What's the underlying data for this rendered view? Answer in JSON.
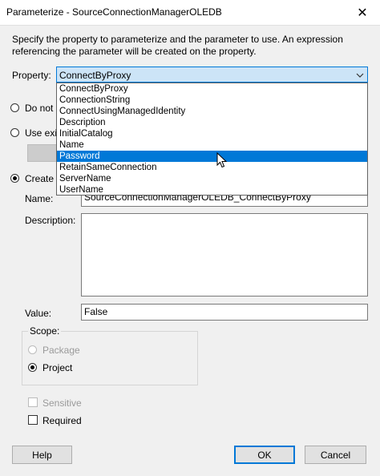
{
  "window": {
    "title": "Parameterize - SourceConnectionManagerOLEDB"
  },
  "description": "Specify the property to parameterize and the parameter to use. An expression referencing the parameter will be created on the property.",
  "property": {
    "label": "Property:",
    "selected": "ConnectByProxy",
    "options": [
      "ConnectByProxy",
      "ConnectionString",
      "ConnectUsingManagedIdentity",
      "Description",
      "InitialCatalog",
      "Name",
      "Password",
      "RetainSameConnection",
      "ServerName",
      "UserName"
    ],
    "highlighted": "Password"
  },
  "options": {
    "do_not": "Do not u",
    "use_existing": "Use exis",
    "create_new": "Create n"
  },
  "name": {
    "label": "Name:",
    "value": "SourceConnectionManagerOLEDB_ConnectByProxy"
  },
  "description_field": {
    "label": "Description:",
    "value": ""
  },
  "value_field": {
    "label": "Value:",
    "value": "False"
  },
  "scope": {
    "title": "Scope:",
    "package": "Package",
    "project": "Project",
    "selected": "Project"
  },
  "sensitive": {
    "label": "Sensitive",
    "checked": false,
    "enabled": false
  },
  "required": {
    "label": "Required",
    "checked": false
  },
  "buttons": {
    "help": "Help",
    "ok": "OK",
    "cancel": "Cancel"
  },
  "icons": {
    "close": "close-icon",
    "dropdown": "chevron-down-icon",
    "cursor": "mouse-pointer-icon"
  },
  "colors": {
    "accent": "#0078d7",
    "selection": "#0078d7"
  }
}
